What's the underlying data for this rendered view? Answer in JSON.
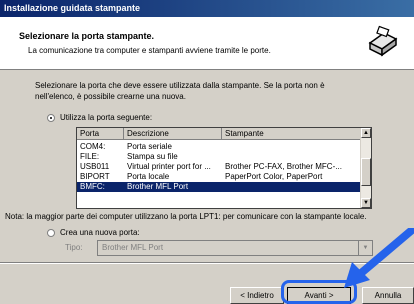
{
  "window": {
    "title": "Installazione guidata stampante"
  },
  "header": {
    "title": "Selezionare la porta stampante.",
    "subtitle": "La comunicazione tra computer e stampanti avviene tramite le porte.",
    "icon": "printer-port-icon"
  },
  "instructions": {
    "line1": "Selezionare la porta che deve essere utilizzata dalla stampante. Se la porta non è",
    "line2": "nell'elenco, è possibile crearne una nuova."
  },
  "use_port": {
    "label": "Utilizza la porta seguente:",
    "checked": true
  },
  "port_list": {
    "columns": [
      "Porta",
      "Descrizione",
      "Stampante"
    ],
    "rows": [
      {
        "porta": "COM4:",
        "descrizione": "Porta seriale",
        "stampante": ""
      },
      {
        "porta": "FILE:",
        "descrizione": "Stampa su file",
        "stampante": ""
      },
      {
        "porta": "USB011",
        "descrizione": "Virtual printer port for ...",
        "stampante": "Brother PC-FAX, Brother MFC-..."
      },
      {
        "porta": "BIPORT",
        "descrizione": "Porta locale",
        "stampante": "PaperPort Color, PaperPort"
      },
      {
        "porta": "BMFC:",
        "descrizione": "Brother MFL Port",
        "stampante": ""
      }
    ],
    "selected_index": 4
  },
  "note": "Nota: la maggior parte dei computer utilizzano la porta LPT1: per comunicare con la stampante locale.",
  "new_port": {
    "label": "Crea una nuova porta:",
    "checked": false,
    "type_label": "Tipo:",
    "type_value": "Brother MFL Port"
  },
  "buttons": {
    "back": "< Indietro",
    "next": "Avanti >",
    "cancel": "Annulla"
  },
  "colors": {
    "highlight": "#2563eb",
    "selection": "#0a246a"
  }
}
